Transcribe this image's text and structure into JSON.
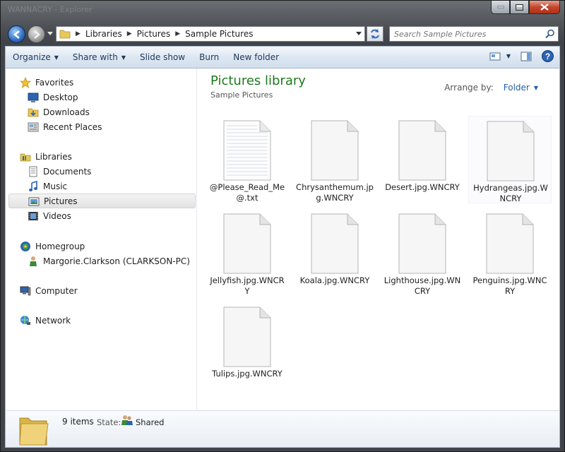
{
  "window": {
    "ghost_title": "WANNACRY - Explorer"
  },
  "address": {
    "segments": [
      "Libraries",
      "Pictures",
      "Sample Pictures"
    ]
  },
  "search": {
    "placeholder": "Search Sample Pictures"
  },
  "toolbar": {
    "organize": "Organize",
    "share_with": "Share with",
    "slide_show": "Slide show",
    "burn": "Burn",
    "new_folder": "New folder"
  },
  "nav": {
    "favorites": "Favorites",
    "desktop": "Desktop",
    "downloads": "Downloads",
    "recent_places": "Recent Places",
    "libraries": "Libraries",
    "documents": "Documents",
    "music": "Music",
    "pictures": "Pictures",
    "videos": "Videos",
    "homegroup": "Homegroup",
    "homegroup_user": "Margorie.Clarkson (CLARKSON-PC)",
    "computer": "Computer",
    "network": "Network"
  },
  "main": {
    "title": "Pictures library",
    "subtitle": "Sample Pictures",
    "arrange_label": "Arrange by:",
    "arrange_value": "Folder"
  },
  "files": [
    {
      "name": "@Please_Read_Me@.txt",
      "icon": "text-file-icon"
    },
    {
      "name": "Chrysanthemum.jpg.WNCRY",
      "icon": "blank-file-icon"
    },
    {
      "name": "Desert.jpg.WNCRY",
      "icon": "blank-file-icon"
    },
    {
      "name": "Hydrangeas.jpg.WNCRY",
      "icon": "blank-file-icon"
    },
    {
      "name": "Jellyfish.jpg.WNCRY",
      "icon": "blank-file-icon"
    },
    {
      "name": "Koala.jpg.WNCRY",
      "icon": "blank-file-icon"
    },
    {
      "name": "Lighthouse.jpg.WNCRY",
      "icon": "blank-file-icon"
    },
    {
      "name": "Penguins.jpg.WNCRY",
      "icon": "blank-file-icon"
    },
    {
      "name": "Tulips.jpg.WNCRY",
      "icon": "blank-file-icon"
    }
  ],
  "status": {
    "count": "9 items",
    "state_label": "State:",
    "state_value": "Shared"
  },
  "colors": {
    "library_title": "#1e7a1e",
    "link": "#1f5fa9",
    "selection": "#e2e2e2"
  }
}
